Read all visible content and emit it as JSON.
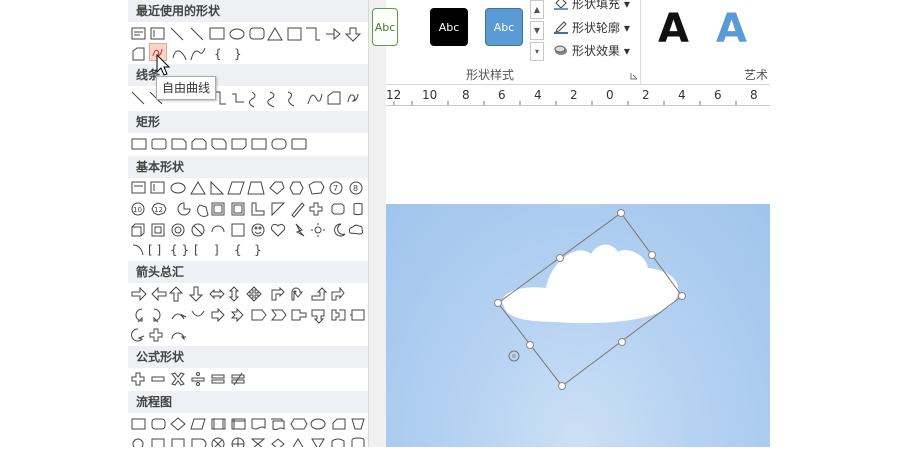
{
  "gallery": {
    "sections": [
      {
        "id": "recent",
        "label": "最近使用的形状"
      },
      {
        "id": "lines",
        "label": "线条"
      },
      {
        "id": "rect",
        "label": "矩形"
      },
      {
        "id": "basic",
        "label": "基本形状"
      },
      {
        "id": "arrows",
        "label": "箭头总汇"
      },
      {
        "id": "equation",
        "label": "公式形状"
      },
      {
        "id": "flowchart",
        "label": "流程图"
      }
    ],
    "tooltip": "自由曲线",
    "selected_tool": "freeform-scribble"
  },
  "ribbon": {
    "style_presets": [
      {
        "label": "Abc",
        "bg": "#ffffff",
        "fg": "#3a7a2a",
        "border": "#5aa040"
      },
      {
        "label": "Abc",
        "bg": "#000000",
        "fg": "#ffffff",
        "border": "#000000"
      },
      {
        "label": "Abc",
        "bg": "#5b9bd5",
        "fg": "#ffffff",
        "border": "#41719c"
      }
    ],
    "fill_label": "形状填充",
    "outline_label": "形状轮廓",
    "effect_label": "形状效果",
    "group_label": "形状样式",
    "art_group_label": "艺术",
    "art_letters": [
      "A",
      "A"
    ]
  },
  "ruler": {
    "numbers": [
      "12",
      "10",
      "8",
      "6",
      "4",
      "2",
      "0",
      "2",
      "4",
      "6",
      "8"
    ]
  },
  "colors": {
    "accent": "#5b9bd5",
    "slide_bg": "#a9ccf0",
    "cloud": "#ffffff",
    "handle": "#ffffff"
  }
}
